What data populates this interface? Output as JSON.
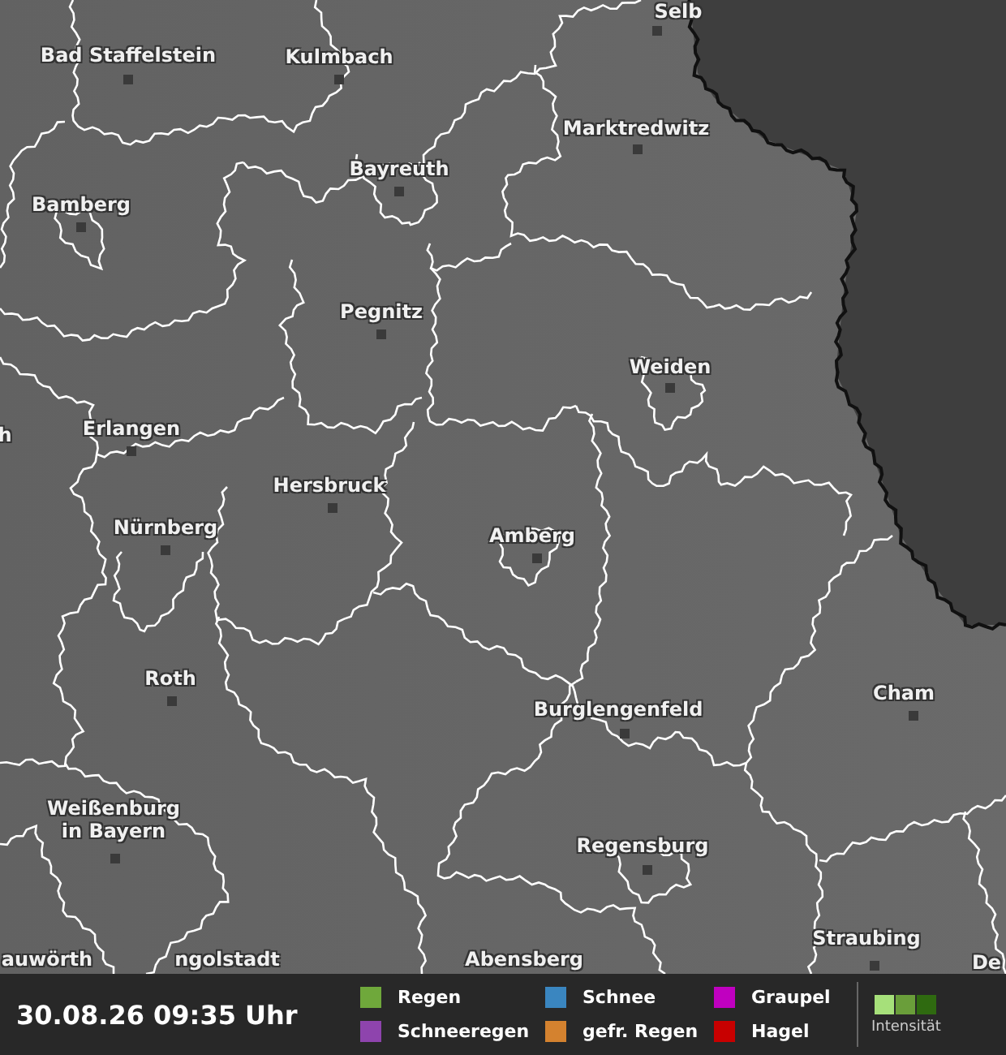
{
  "map": {
    "cities": [
      {
        "name": "Selb"
      },
      {
        "name": "Bad Staffelstein"
      },
      {
        "name": "Kulmbach"
      },
      {
        "name": "Marktredwitz"
      },
      {
        "name": "Bayreuth"
      },
      {
        "name": "Bamberg"
      },
      {
        "name": "Pegnitz"
      },
      {
        "name": "Weiden"
      },
      {
        "name": "h"
      },
      {
        "name": "Erlangen"
      },
      {
        "name": "Hersbruck"
      },
      {
        "name": "Nürnberg"
      },
      {
        "name": "Amberg"
      },
      {
        "name": "Roth"
      },
      {
        "name": "Cham"
      },
      {
        "name": "Burglengenfeld"
      },
      {
        "name": "Weißenburg in Bayern"
      },
      {
        "name": "Regensburg"
      },
      {
        "name": "Straubing"
      },
      {
        "name": "auwörth"
      },
      {
        "name": "ngolstadt"
      },
      {
        "name": "Abensberg"
      },
      {
        "name": "De"
      }
    ]
  },
  "legend_bar": {
    "timestamp": "30.08.26 09:35 Uhr",
    "precipitation_types": [
      {
        "label": "Regen",
        "color": "#6fa83b"
      },
      {
        "label": "Schnee",
        "color": "#3a86c0"
      },
      {
        "label": "Graupel",
        "color": "#c000c0"
      },
      {
        "label": "Schneeregen",
        "color": "#8e44ad"
      },
      {
        "label": "gefr. Regen",
        "color": "#d4822f"
      },
      {
        "label": "Hagel",
        "color": "#c80000"
      }
    ],
    "intensity": {
      "label": "Intensität"
    }
  }
}
